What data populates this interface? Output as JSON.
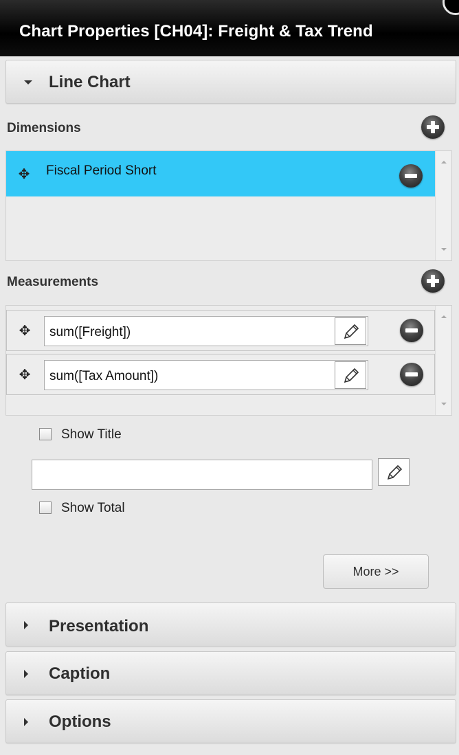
{
  "window": {
    "title": "Chart Properties [CH04]: Freight & Tax Trend"
  },
  "sections": {
    "line_chart": {
      "label": "Line Chart",
      "expanded": true
    },
    "presentation": {
      "label": "Presentation",
      "expanded": false
    },
    "caption": {
      "label": "Caption",
      "expanded": false
    },
    "options": {
      "label": "Options",
      "expanded": false
    }
  },
  "dimensions": {
    "heading": "Dimensions",
    "items": [
      {
        "label": "Fiscal Period Short",
        "selected": true
      }
    ]
  },
  "measurements": {
    "heading": "Measurements",
    "items": [
      {
        "expression": "sum([Freight])"
      },
      {
        "expression": "sum([Tax Amount])"
      }
    ]
  },
  "show_title": {
    "label": "Show Title",
    "checked": false,
    "value": ""
  },
  "show_total": {
    "label": "Show Total",
    "checked": false
  },
  "more_button": {
    "label": "More >>"
  },
  "colors": {
    "selected_row": "#33c8f7",
    "title_bar": "#000000"
  }
}
